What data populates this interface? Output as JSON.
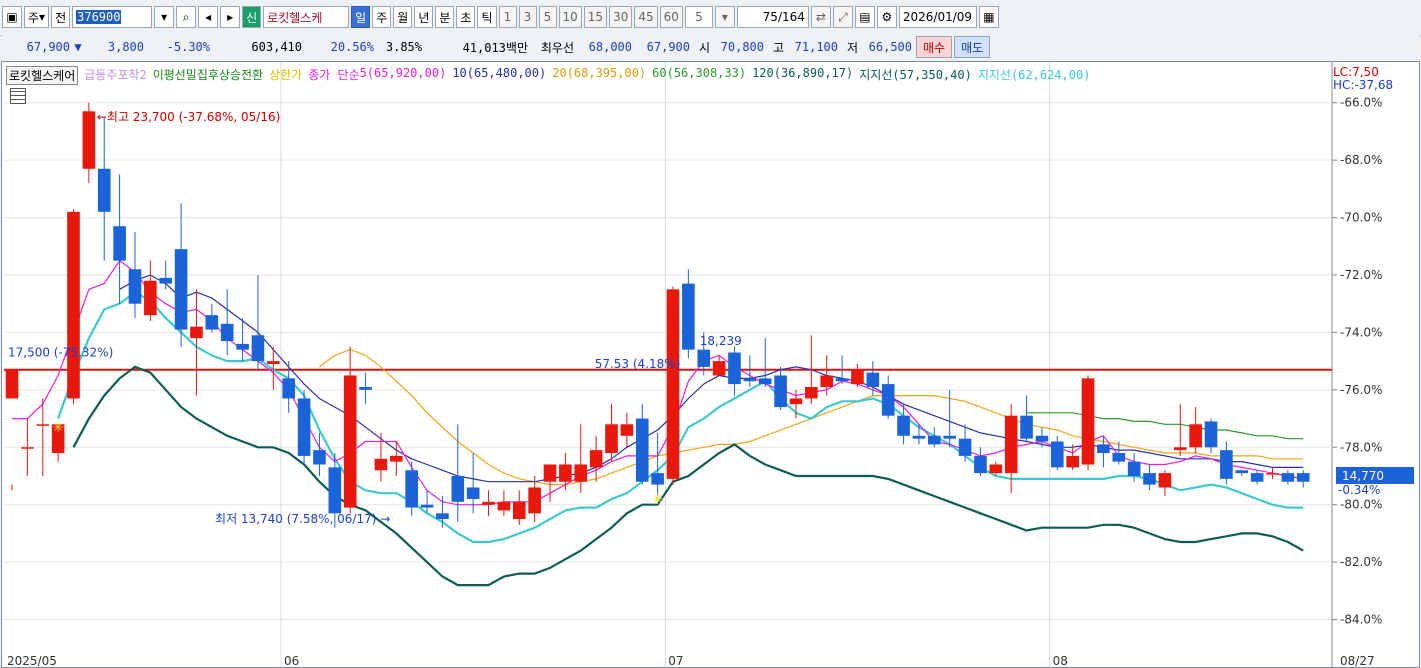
{
  "toolbar": {
    "period_btn": "주",
    "price_btn": "전",
    "stock_code": "376900",
    "stock_name_badge": "신",
    "stock_name": "로킷헬스케",
    "periods": [
      "일",
      "주",
      "월",
      "년",
      "분",
      "초",
      "틱"
    ],
    "active_period": "일",
    "nums": [
      "1",
      "3",
      "5",
      "10",
      "15",
      "30",
      "45",
      "60"
    ],
    "count_sel": "5",
    "count": "75",
    "total": "/164",
    "date": "2026/01/09"
  },
  "quote": {
    "price": "67,900",
    "arrow": "▼",
    "change": "3,800",
    "change_pct": "-5.30%",
    "volume": "603,410",
    "turnover": "20.56%",
    "ratio": "3.85%",
    "amount": "41,013백만",
    "bid_label": "최우선",
    "bid": "68,000",
    "ask": "67,900",
    "open_label": "시",
    "open": "70,800",
    "high_label": "고",
    "high": "71,100",
    "low_label": "저",
    "low": "66,500",
    "buy": "매수",
    "sell": "매도"
  },
  "legend": {
    "name": "로킷헬스케어",
    "ind1": "급등주포착2",
    "ind2": "이평선밀집후상승전환",
    "ind3": "상한가",
    "ma_prefix": "종가 단순",
    "ma5": "5(65,920,00)",
    "ma10": "10(65,480,00)",
    "ma20": "20(68,395,00)",
    "ma60": "60(56,308,33)",
    "ma120": "120(36,890,17)",
    "sup1": "지지선(57,350,40)",
    "sup2": "지지선(62,624,00)"
  },
  "lc": "LC:7,50",
  "hc": "HC:-37,68",
  "colors": {
    "up": "#e8180c",
    "down": "#1b63d8",
    "ma5": "#e81ee0",
    "ma10": "#2a2eaa",
    "ma20": "#f0a418",
    "ma60": "#2a9a2a",
    "sup1": "#0d5c55",
    "sup2": "#3dc9d0",
    "hline": "#e01010"
  },
  "annotations": {
    "high": "←최고 23,700 (-37.68%, 05/16)",
    "low": "최저 13,740 (7.58%, 06/17) →",
    "level1": "17,500 (-75.32%)",
    "level2": "57.53 (4.18%)",
    "vol": "18,239"
  },
  "current_price": "14,770",
  "current_pct": "-0.34%",
  "chart_data": {
    "type": "candlestick",
    "title": "로킷헬스케어",
    "y_axis": {
      "min": -85.2,
      "max": -65.0,
      "ticks": [
        "-66.0%",
        "-68.0%",
        "-70.0%",
        "-72.0%",
        "-74.0%",
        "-76.0%",
        "-78.0%",
        "-80.0%",
        "-82.0%",
        "-84.0%"
      ]
    },
    "x_labels": [
      "2025/05",
      "06",
      "07",
      "08",
      "08/27"
    ],
    "candles": [
      [
        -76.3,
        -75.3,
        -79.3,
        -79.5
      ],
      [
        -78.0,
        -78.0,
        -77.0,
        -79.0
      ],
      [
        -77.2,
        -77.2,
        -76.3,
        -79.0
      ],
      [
        -78.2,
        -77.2,
        -77.2,
        -78.5
      ],
      [
        -76.3,
        -69.8,
        -69.7,
        -76.5
      ],
      [
        -68.3,
        -66.3,
        -66.0,
        -68.8
      ],
      [
        -68.3,
        -69.8,
        -66.5,
        -71.5
      ],
      [
        -70.3,
        -71.5,
        -68.5,
        -73.0
      ],
      [
        -71.8,
        -73.0,
        -70.5,
        -73.5
      ],
      [
        -73.4,
        -72.2,
        -71.5,
        -73.6
      ],
      [
        -72.1,
        -72.3,
        -71.5,
        -72.5
      ],
      [
        -71.1,
        -73.9,
        -69.5,
        -74.5
      ],
      [
        -74.2,
        -73.8,
        -72.5,
        -76.2
      ],
      [
        -73.4,
        -73.9,
        -73.0,
        -74.0
      ],
      [
        -73.7,
        -74.3,
        -72.5,
        -74.8
      ],
      [
        -74.4,
        -74.6,
        -73.5,
        -75.0
      ],
      [
        -74.1,
        -75.0,
        -72.0,
        -75.3
      ],
      [
        -75.1,
        -75.0,
        -74.5,
        -76.0
      ],
      [
        -75.6,
        -76.3,
        -75.0,
        -76.8
      ],
      [
        -76.3,
        -78.3,
        -76.0,
        -78.6
      ],
      [
        -78.1,
        -78.6,
        -77.5,
        -79.0
      ],
      [
        -78.7,
        -80.3,
        -78.2,
        -80.8
      ],
      [
        -80.1,
        -75.5,
        -74.5,
        -80.3
      ],
      [
        -75.9,
        -76.0,
        -75.4,
        -76.5
      ],
      [
        -78.8,
        -78.4,
        -77.5,
        -79.2
      ],
      [
        -78.5,
        -78.3,
        -77.8,
        -79.0
      ],
      [
        -78.8,
        -80.1,
        -78.5,
        -80.4
      ],
      [
        -80.0,
        -80.1,
        -79.5,
        -80.3
      ],
      [
        -80.3,
        -80.5,
        -79.7,
        -80.8
      ],
      [
        -79.0,
        -79.9,
        -77.2,
        -80.6
      ],
      [
        -79.4,
        -79.8,
        -78.2,
        -80.3
      ],
      [
        -80.0,
        -79.9,
        -79.5,
        -80.4
      ],
      [
        -80.2,
        -79.9,
        -79.5,
        -80.4
      ],
      [
        -80.5,
        -79.9,
        -79.5,
        -80.7
      ],
      [
        -80.3,
        -79.4,
        -79.0,
        -80.6
      ],
      [
        -79.2,
        -78.6,
        -78.6,
        -79.9
      ],
      [
        -79.2,
        -78.6,
        -78.2,
        -79.5
      ],
      [
        -79.2,
        -78.6,
        -77.2,
        -79.6
      ],
      [
        -78.7,
        -78.1,
        -77.6,
        -79.2
      ],
      [
        -78.2,
        -77.2,
        -76.5,
        -78.5
      ],
      [
        -77.6,
        -77.2,
        -76.8,
        -78.0
      ],
      [
        -77.0,
        -79.2,
        -76.5,
        -79.3
      ],
      [
        -78.9,
        -79.3,
        -77.5,
        -79.7
      ],
      [
        -79.1,
        -72.5,
        -72.4,
        -79.3
      ],
      [
        -72.3,
        -74.6,
        -71.8,
        -74.9
      ],
      [
        -74.6,
        -75.2,
        -74.0,
        -75.5
      ],
      [
        -75.5,
        -75.0,
        -74.8,
        -75.5
      ],
      [
        -74.7,
        -75.8,
        -74.5,
        -76.2
      ],
      [
        -75.6,
        -75.7,
        -74.8,
        -75.9
      ],
      [
        -75.6,
        -75.8,
        -74.2,
        -75.9
      ],
      [
        -75.5,
        -76.6,
        -75.2,
        -76.7
      ],
      [
        -76.5,
        -76.3,
        -76.0,
        -77.0
      ],
      [
        -76.3,
        -75.9,
        -74.1,
        -76.5
      ],
      [
        -75.9,
        -75.5,
        -74.8,
        -76.2
      ],
      [
        -75.6,
        -75.7,
        -74.8,
        -75.8
      ],
      [
        -75.8,
        -75.3,
        -75.1,
        -75.9
      ],
      [
        -75.4,
        -75.9,
        -75.0,
        -76.2
      ],
      [
        -75.8,
        -76.9,
        -75.5,
        -77.0
      ],
      [
        -76.9,
        -77.6,
        -76.5,
        -77.9
      ],
      [
        -77.6,
        -77.7,
        -77.2,
        -77.9
      ],
      [
        -77.6,
        -77.9,
        -77.3,
        -78.0
      ],
      [
        -77.6,
        -77.7,
        -76.0,
        -78.0
      ],
      [
        -77.7,
        -78.3,
        -77.2,
        -78.5
      ],
      [
        -78.3,
        -78.9,
        -78.0,
        -79.0
      ],
      [
        -78.9,
        -78.6,
        -78.5,
        -79.0
      ],
      [
        -78.9,
        -76.9,
        -76.5,
        -79.6
      ],
      [
        -76.9,
        -77.7,
        -76.2,
        -77.8
      ],
      [
        -77.6,
        -77.8,
        -77.3,
        -78.0
      ],
      [
        -77.8,
        -78.7,
        -77.6,
        -78.8
      ],
      [
        -78.7,
        -78.3,
        -77.9,
        -78.8
      ],
      [
        -78.6,
        -75.6,
        -75.5,
        -78.8
      ],
      [
        -77.9,
        -78.2,
        -77.6,
        -78.7
      ],
      [
        -78.2,
        -78.5,
        -77.8,
        -78.6
      ],
      [
        -78.5,
        -79.0,
        -78.2,
        -79.2
      ],
      [
        -78.9,
        -79.3,
        -78.6,
        -79.5
      ],
      [
        -79.4,
        -78.9,
        -78.8,
        -79.7
      ],
      [
        -78.1,
        -78.0,
        -76.5,
        -78.3
      ],
      [
        -78.0,
        -77.2,
        -76.6,
        -78.2
      ],
      [
        -77.1,
        -78.0,
        -77.0,
        -78.2
      ],
      [
        -78.1,
        -79.1,
        -77.8,
        -79.3
      ],
      [
        -78.8,
        -78.9,
        -78.8,
        -79.0
      ],
      [
        -78.9,
        -79.2,
        -78.8,
        -79.3
      ],
      [
        -78.9,
        -78.9,
        -78.7,
        -79.1
      ],
      [
        -78.9,
        -79.2,
        -78.8,
        -79.3
      ],
      [
        -78.9,
        -79.2,
        -78.8,
        -79.4
      ]
    ],
    "ma5": [
      -77.0,
      -77.0,
      -76.5,
      -75.5,
      -74.0,
      -72.5,
      -72.3,
      -71.5,
      -71.9,
      -72.6,
      -73.0,
      -73.3,
      -73.2,
      -73.6,
      -74.2,
      -74.6,
      -75.0,
      -75.4,
      -76.0,
      -77.0,
      -78.0,
      -78.5,
      -78.2,
      -77.8,
      -77.8,
      -77.8,
      -78.7,
      -79.5,
      -79.9,
      -80.0,
      -80.0,
      -80.0,
      -79.9,
      -79.9,
      -79.9,
      -79.6,
      -79.3,
      -79.0,
      -78.8,
      -78.5,
      -78.3,
      -78.3,
      -78.3,
      -77.3,
      -75.7,
      -75.0,
      -74.8,
      -75.2,
      -75.5,
      -75.8,
      -76.0,
      -76.2,
      -76.1,
      -76.0,
      -75.7,
      -75.8,
      -76.0,
      -76.2,
      -76.6,
      -77.2,
      -77.8,
      -77.9,
      -78.1,
      -78.3,
      -78.2,
      -78.0,
      -77.9,
      -77.8,
      -78.0,
      -78.2,
      -77.8,
      -77.6,
      -78.3,
      -78.5,
      -78.6,
      -78.6,
      -78.5,
      -78.3,
      -78.4,
      -78.6,
      -78.7,
      -78.8,
      -78.9,
      -79.0,
      -79.1
    ],
    "ma10": [
      null,
      null,
      null,
      null,
      null,
      null,
      null,
      -72.5,
      -72.2,
      -72.0,
      -72.3,
      -72.8,
      -72.6,
      -72.8,
      -73.2,
      -73.6,
      -74.0,
      -74.6,
      -75.2,
      -75.8,
      -76.3,
      -76.6,
      -76.9,
      -77.3,
      -77.7,
      -78.1,
      -78.4,
      -78.6,
      -78.8,
      -79.0,
      -79.1,
      -79.2,
      -79.2,
      -79.2,
      -79.2,
      -79.1,
      -79.0,
      -78.9,
      -78.7,
      -78.4,
      -78.0,
      -77.7,
      -77.4,
      -76.9,
      -76.3,
      -75.8,
      -75.5,
      -75.6,
      -75.6,
      -75.5,
      -75.3,
      -75.2,
      -75.3,
      -75.5,
      -75.6,
      -75.7,
      -75.9,
      -76.2,
      -76.5,
      -76.7,
      -76.9,
      -77.1,
      -77.3,
      -77.5,
      -77.6,
      -77.7,
      -77.8,
      -77.9,
      -78.0,
      -78.0,
      -77.9,
      -78.0,
      -78.1,
      -78.1,
      -78.2,
      -78.3,
      -78.4,
      -78.4,
      -78.4,
      -78.5,
      -78.5,
      -78.6,
      -78.7,
      -78.7,
      -78.7
    ],
    "ma20": [
      null,
      null,
      null,
      null,
      null,
      null,
      null,
      null,
      null,
      null,
      null,
      null,
      null,
      null,
      null,
      null,
      null,
      null,
      null,
      null,
      -75.2,
      -74.8,
      -74.6,
      -74.8,
      -75.2,
      -75.7,
      -76.2,
      -76.8,
      -77.3,
      -77.8,
      -78.2,
      -78.6,
      -78.9,
      -79.1,
      -79.2,
      -79.3,
      -79.3,
      -79.2,
      -79.1,
      -78.9,
      -78.7,
      -78.5,
      -78.3,
      -78.2,
      -78.1,
      -78.0,
      -77.9,
      -77.9,
      -77.8,
      -77.6,
      -77.4,
      -77.2,
      -77.0,
      -76.8,
      -76.6,
      -76.4,
      -76.2,
      -76.2,
      -76.2,
      -76.2,
      -76.2,
      -76.3,
      -76.4,
      -76.6,
      -76.8,
      -77.0,
      -77.2,
      -77.3,
      -77.4,
      -77.6,
      -77.7,
      -77.8,
      -77.9,
      -78.0,
      -78.1,
      -78.2,
      -78.2,
      -78.2,
      -78.3,
      -78.3,
      -78.3,
      -78.3,
      -78.4,
      -78.4,
      -78.4
    ],
    "ma60": [
      null,
      null,
      null,
      null,
      null,
      null,
      null,
      null,
      null,
      null,
      null,
      null,
      null,
      null,
      null,
      null,
      null,
      null,
      null,
      null,
      null,
      null,
      null,
      null,
      null,
      null,
      null,
      null,
      null,
      null,
      null,
      null,
      null,
      null,
      null,
      null,
      null,
      null,
      null,
      null,
      null,
      null,
      null,
      null,
      null,
      null,
      null,
      null,
      null,
      null,
      null,
      null,
      null,
      null,
      null,
      null,
      null,
      null,
      null,
      null,
      null,
      null,
      null,
      null,
      null,
      null,
      -76.8,
      -76.8,
      -76.8,
      -76.8,
      -76.9,
      -77.0,
      -77.0,
      -77.1,
      -77.1,
      -77.2,
      -77.2,
      -77.3,
      -77.4,
      -77.4,
      -77.5,
      -77.6,
      -77.6,
      -77.7,
      -77.7
    ],
    "sup1": [
      null,
      null,
      null,
      null,
      -78.0,
      -77.0,
      -76.2,
      -75.6,
      -75.2,
      -75.4,
      -76.0,
      -76.6,
      -77.0,
      -77.3,
      -77.6,
      -77.8,
      -78.0,
      -78.0,
      -78.2,
      -78.6,
      -79.2,
      -79.7,
      -80.0,
      -80.2,
      -80.6,
      -81.0,
      -81.5,
      -82.0,
      -82.5,
      -82.8,
      -82.8,
      -82.8,
      -82.5,
      -82.4,
      -82.4,
      -82.2,
      -81.9,
      -81.6,
      -81.2,
      -80.8,
      -80.3,
      -80.0,
      -80.0,
      -79.2,
      -79.0,
      -78.6,
      -78.2,
      -77.9,
      -78.3,
      -78.6,
      -78.8,
      -79.0,
      -79.0,
      -79.0,
      -79.0,
      -79.0,
      -79.0,
      -79.1,
      -79.3,
      -79.5,
      -79.7,
      -79.9,
      -80.1,
      -80.3,
      -80.5,
      -80.7,
      -80.9,
      -80.8,
      -80.8,
      -80.8,
      -80.8,
      -80.7,
      -80.7,
      -80.8,
      -81.0,
      -81.2,
      -81.3,
      -81.3,
      -81.2,
      -81.1,
      -81.0,
      -81.0,
      -81.1,
      -81.3,
      -81.6
    ],
    "sup2": [
      null,
      null,
      null,
      -77.0,
      -75.5,
      -74.2,
      -73.2,
      -73.0,
      -72.6,
      -72.9,
      -73.5,
      -74.0,
      -74.5,
      -74.8,
      -75.0,
      -75.0,
      -74.9,
      -75.3,
      -75.6,
      -76.2,
      -77.4,
      -78.4,
      -79.2,
      -79.5,
      -79.6,
      -79.6,
      -79.9,
      -80.3,
      -80.6,
      -81.0,
      -81.3,
      -81.3,
      -81.2,
      -81.0,
      -80.8,
      -80.5,
      -80.2,
      -80.1,
      -80.1,
      -79.8,
      -79.6,
      -79.2,
      -78.8,
      -78.3,
      -77.3,
      -77.0,
      -76.6,
      -76.3,
      -76.0,
      -75.7,
      -76.3,
      -76.8,
      -77.0,
      -76.6,
      -76.4,
      -76.4,
      -76.3,
      -76.5,
      -76.9,
      -77.3,
      -77.6,
      -77.9,
      -78.3,
      -78.7,
      -79.0,
      -79.1,
      -79.1,
      -79.1,
      -79.1,
      -79.1,
      -79.1,
      -79.1,
      -79.0,
      -79.0,
      -79.1,
      -79.3,
      -79.5,
      -79.4,
      -79.3,
      -79.4,
      -79.6,
      -79.8,
      -80.0,
      -80.1,
      -80.1
    ],
    "hline": -75.3
  }
}
